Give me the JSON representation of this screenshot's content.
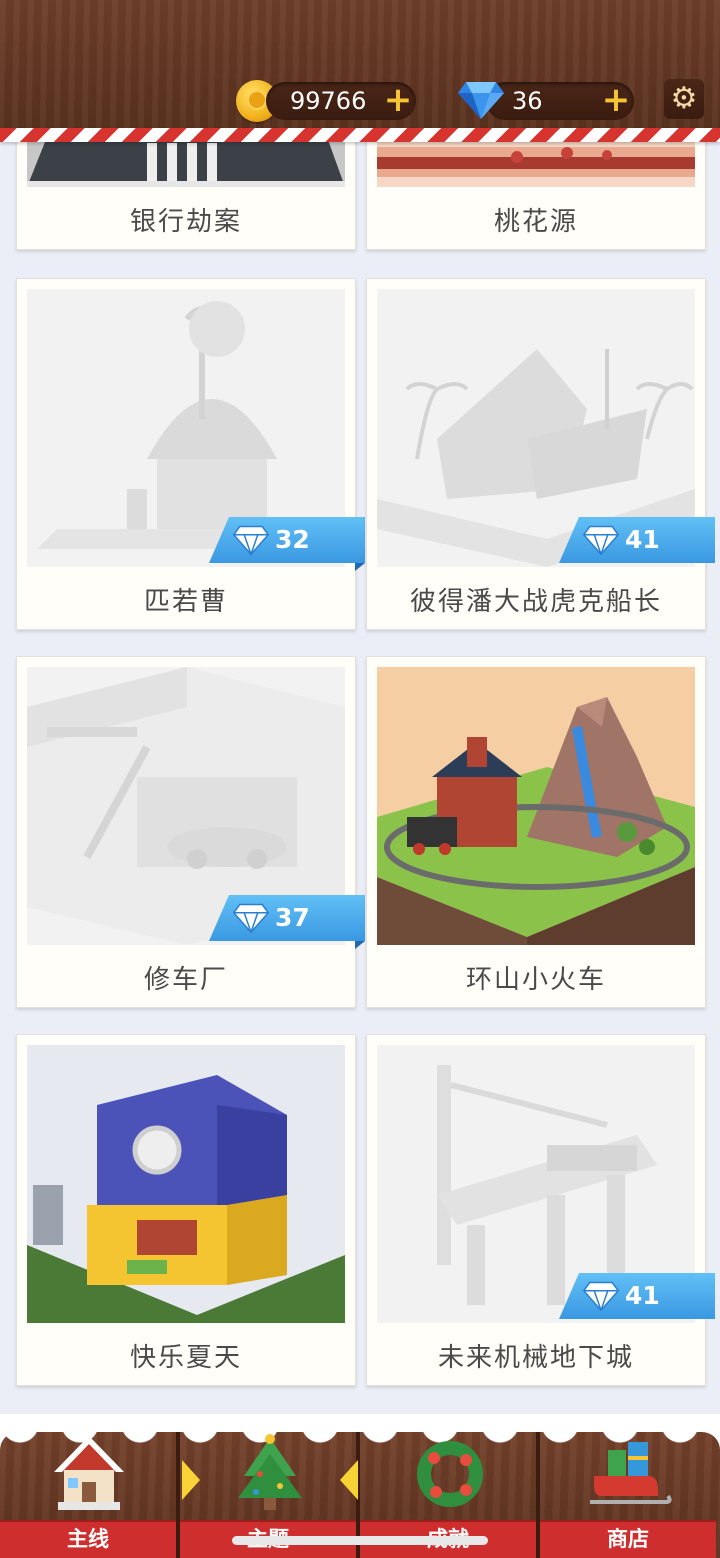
{
  "header": {
    "coins": "99766",
    "gems": "36",
    "plus": "+",
    "settings_icon": "gear-icon"
  },
  "cards": [
    {
      "title": "银行劫案",
      "price": null
    },
    {
      "title": "桃花源",
      "price": null
    },
    {
      "title": "匹若曹",
      "price": "32"
    },
    {
      "title": "彼得潘大战虎克船长",
      "price": "41"
    },
    {
      "title": "修车厂",
      "price": "37"
    },
    {
      "title": "环山小火车",
      "price": null
    },
    {
      "title": "快乐夏天",
      "price": null
    },
    {
      "title": "未来机械地下城",
      "price": "41"
    }
  ],
  "nav": [
    {
      "label": "主线",
      "icon": "house-icon"
    },
    {
      "label": "主题",
      "icon": "christmas-tree-icon"
    },
    {
      "label": "成就",
      "icon": "wreath-icon"
    },
    {
      "label": "商店",
      "icon": "sleigh-icon"
    }
  ],
  "colors": {
    "wood": "#6e3f2a",
    "ribbon_blue": "#3a98e2",
    "tab_red": "#cf2e2e",
    "gold": "#f7c531"
  }
}
